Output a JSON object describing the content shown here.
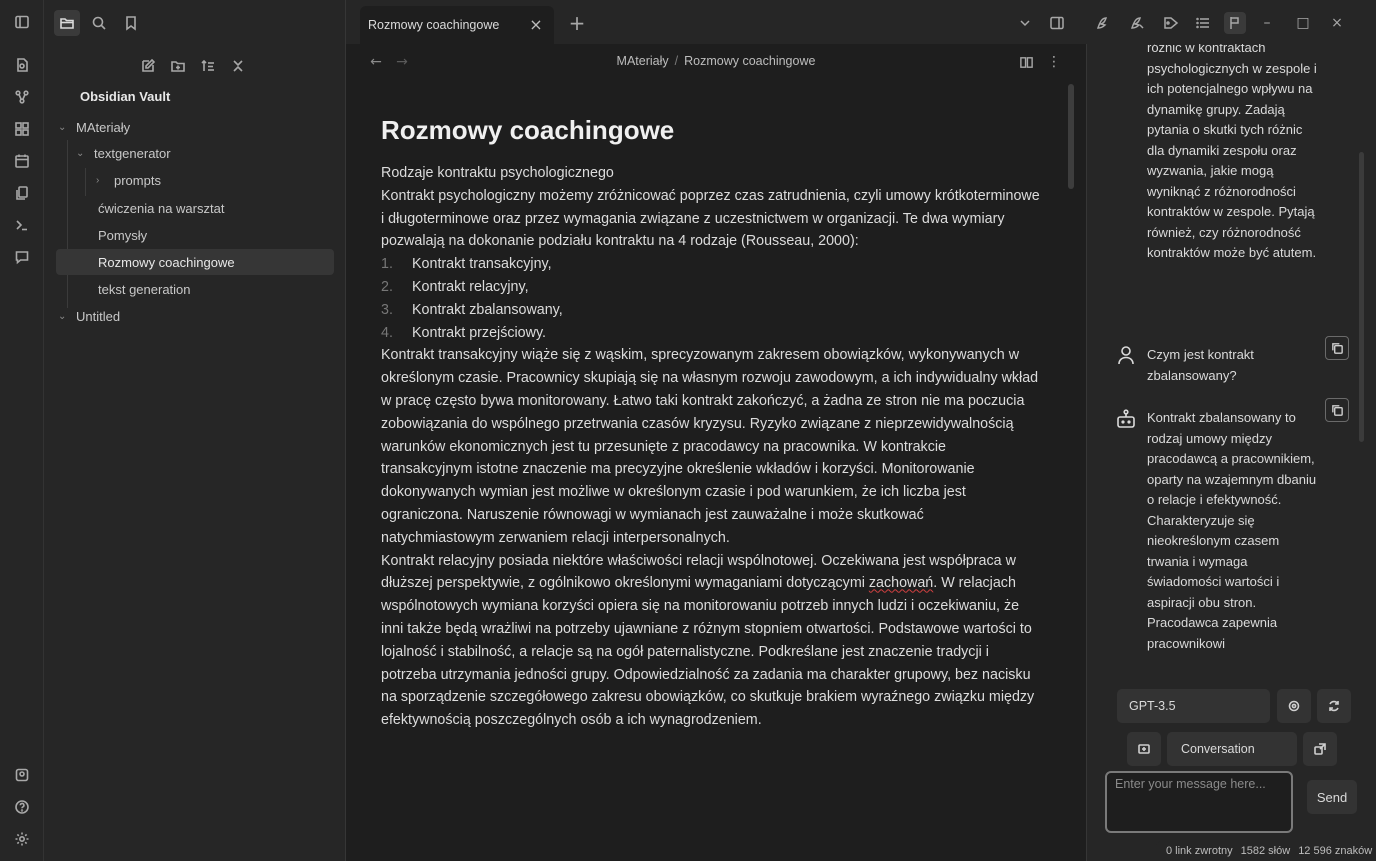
{
  "tab": {
    "title": "Rozmowy coachingowe"
  },
  "breadcrumb": {
    "folder": "MAteriały",
    "separator": "/",
    "file": "Rozmowy coachingowe"
  },
  "sidebar": {
    "vault_name": "Obsidian Vault",
    "tree": [
      {
        "label": "MAteriały",
        "level": 0,
        "chevron": "down"
      },
      {
        "label": "textgenerator",
        "level": 1,
        "chevron": "down"
      },
      {
        "label": "prompts",
        "level": 2,
        "chevron": "right"
      },
      {
        "label": "ćwiczenia na warsztat",
        "level": 1,
        "chevron": ""
      },
      {
        "label": "Pomysły",
        "level": 1,
        "chevron": ""
      },
      {
        "label": "Rozmowy coachingowe",
        "level": 1,
        "chevron": "",
        "selected": true
      },
      {
        "label": "tekst generation",
        "level": 1,
        "chevron": ""
      },
      {
        "label": "Untitled",
        "level": 0,
        "chevron": "down"
      }
    ]
  },
  "document": {
    "title": "Rozmowy coachingowe",
    "p1": "Rodzaje kontraktu psychologicznego",
    "p2": "Kontrakt psychologiczny możemy zróżnicować poprzez czas zatrudnienia, czyli umowy krótkoterminowe i długoterminowe oraz przez wymagania związane z uczestnictwem w organizacji. Te dwa wymiary pozwalają na dokonanie podziału kontraktu na 4 rodzaje (Rousseau, 2000):",
    "list": [
      {
        "num": "1.",
        "text": "Kontrakt transakcyjny,"
      },
      {
        "num": "2.",
        "text": "Kontrakt relacyjny,"
      },
      {
        "num": "3.",
        "text": "Kontrakt zbalansowany,"
      },
      {
        "num": "4.",
        "text": "Kontrakt przejściowy."
      }
    ],
    "p3": "Kontrakt transakcyjny wiąże się z wąskim, sprecyzowanym zakresem obowiązków, wykonywanych w określonym czasie. Pracownicy skupiają się na własnym rozwoju zawodowym, a ich indywidualny wkład w pracę często bywa monitorowany. Łatwo taki kontrakt zakończyć, a żadna ze stron nie ma poczucia zobowiązania do wspólnego przetrwania czasów kryzysu. Ryzyko związane z nieprzewidywalnością warunków ekonomicznych jest tu przesunięte z pracodawcy na pracownika. W kontrakcie transakcyjnym istotne znaczenie ma precyzyjne określenie wkładów i korzyści. Monitorowanie dokonywanych wymian jest możliwe w określonym czasie i pod warunkiem, że ich liczba jest ograniczona. Naruszenie równowagi w wymianach jest zauważalne i może skutkować natychmiastowym zerwaniem relacji interpersonalnych.",
    "p4_before": "Kontrakt relacyjny posiada niektóre właściwości relacji wspólnotowej. Oczekiwana jest współpraca w dłuższej perspektywie, z ogólnikowo określonymi wymaganiami dotyczącymi ",
    "p4_misspelled": "zachowań",
    "p4_after": ". W relacjach wspólnotowych wymiana korzyści opiera się na monitorowaniu potrzeb innych ludzi i oczekiwaniu, że inni także będą wrażliwi na potrzeby ujawniane z różnym stopniem otwartości. Podstawowe wartości to lojalność i stabilność, a relacje są na ogół paternalistyczne. Podkreślane jest znaczenie tradycji i potrzeba utrzymania jedności grupy. Odpowiedzialność za zadania ma charakter grupowy, bez nacisku na sporządzenie szczegółowego zakresu obowiązków, co skutkuje brakiem wyraźnego związku między efektywnością poszczególnych osób a ich wynagrodzeniem."
  },
  "chat": {
    "prev_assistant_tail": "różnic w kontraktach psychologicznych w zespole i ich potencjalnego wpływu na dynamikę grupy. Zadają pytania o skutki tych różnic dla dynamiki zespołu oraz wyzwania, jakie mogą wyniknąć z różnorodności kontraktów w zespole. Pytają również, czy różnorodność kontraktów może być atutem.",
    "user_message": "Czym jest kontrakt zbalansowany?",
    "assistant_message": "Kontrakt zbalansowany to rodzaj umowy między pracodawcą a pracownikiem, oparty na wzajemnym dbaniu o relacje i efektywność. Charakteryzuje się nieokreślonym czasem trwania i wymaga świadomości wartości i aspiracji obu stron. Pracodawca zapewnia pracownikowi",
    "model": "GPT-3.5",
    "mode": "Conversation",
    "input_placeholder": "Enter your message here...",
    "send_label": "Send"
  },
  "status_bar": {
    "backlinks": "0 link zwrotny",
    "words": "1582 słów",
    "chars": "12 596 znaków"
  },
  "colors": {
    "background": "#1e1e1e",
    "panel": "#262626",
    "text": "#dadada",
    "misspelling": "#d04040"
  }
}
